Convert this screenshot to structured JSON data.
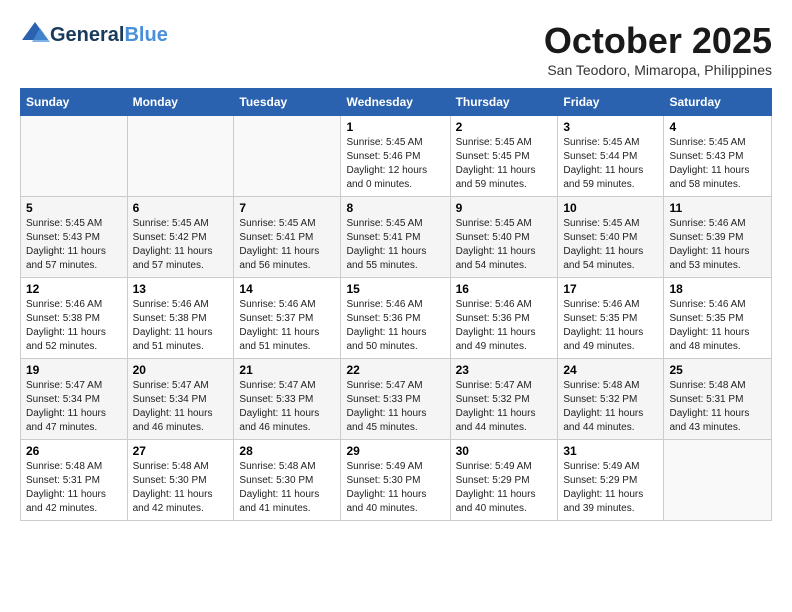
{
  "header": {
    "logo_general": "General",
    "logo_blue": "Blue",
    "month_title": "October 2025",
    "subtitle": "San Teodoro, Mimaropa, Philippines"
  },
  "weekdays": [
    "Sunday",
    "Monday",
    "Tuesday",
    "Wednesday",
    "Thursday",
    "Friday",
    "Saturday"
  ],
  "weeks": [
    [
      {
        "day": "",
        "sunrise": "",
        "sunset": "",
        "daylight": ""
      },
      {
        "day": "",
        "sunrise": "",
        "sunset": "",
        "daylight": ""
      },
      {
        "day": "",
        "sunrise": "",
        "sunset": "",
        "daylight": ""
      },
      {
        "day": "1",
        "sunrise": "Sunrise: 5:45 AM",
        "sunset": "Sunset: 5:46 PM",
        "daylight": "Daylight: 12 hours and 0 minutes."
      },
      {
        "day": "2",
        "sunrise": "Sunrise: 5:45 AM",
        "sunset": "Sunset: 5:45 PM",
        "daylight": "Daylight: 11 hours and 59 minutes."
      },
      {
        "day": "3",
        "sunrise": "Sunrise: 5:45 AM",
        "sunset": "Sunset: 5:44 PM",
        "daylight": "Daylight: 11 hours and 59 minutes."
      },
      {
        "day": "4",
        "sunrise": "Sunrise: 5:45 AM",
        "sunset": "Sunset: 5:43 PM",
        "daylight": "Daylight: 11 hours and 58 minutes."
      }
    ],
    [
      {
        "day": "5",
        "sunrise": "Sunrise: 5:45 AM",
        "sunset": "Sunset: 5:43 PM",
        "daylight": "Daylight: 11 hours and 57 minutes."
      },
      {
        "day": "6",
        "sunrise": "Sunrise: 5:45 AM",
        "sunset": "Sunset: 5:42 PM",
        "daylight": "Daylight: 11 hours and 57 minutes."
      },
      {
        "day": "7",
        "sunrise": "Sunrise: 5:45 AM",
        "sunset": "Sunset: 5:41 PM",
        "daylight": "Daylight: 11 hours and 56 minutes."
      },
      {
        "day": "8",
        "sunrise": "Sunrise: 5:45 AM",
        "sunset": "Sunset: 5:41 PM",
        "daylight": "Daylight: 11 hours and 55 minutes."
      },
      {
        "day": "9",
        "sunrise": "Sunrise: 5:45 AM",
        "sunset": "Sunset: 5:40 PM",
        "daylight": "Daylight: 11 hours and 54 minutes."
      },
      {
        "day": "10",
        "sunrise": "Sunrise: 5:45 AM",
        "sunset": "Sunset: 5:40 PM",
        "daylight": "Daylight: 11 hours and 54 minutes."
      },
      {
        "day": "11",
        "sunrise": "Sunrise: 5:46 AM",
        "sunset": "Sunset: 5:39 PM",
        "daylight": "Daylight: 11 hours and 53 minutes."
      }
    ],
    [
      {
        "day": "12",
        "sunrise": "Sunrise: 5:46 AM",
        "sunset": "Sunset: 5:38 PM",
        "daylight": "Daylight: 11 hours and 52 minutes."
      },
      {
        "day": "13",
        "sunrise": "Sunrise: 5:46 AM",
        "sunset": "Sunset: 5:38 PM",
        "daylight": "Daylight: 11 hours and 51 minutes."
      },
      {
        "day": "14",
        "sunrise": "Sunrise: 5:46 AM",
        "sunset": "Sunset: 5:37 PM",
        "daylight": "Daylight: 11 hours and 51 minutes."
      },
      {
        "day": "15",
        "sunrise": "Sunrise: 5:46 AM",
        "sunset": "Sunset: 5:36 PM",
        "daylight": "Daylight: 11 hours and 50 minutes."
      },
      {
        "day": "16",
        "sunrise": "Sunrise: 5:46 AM",
        "sunset": "Sunset: 5:36 PM",
        "daylight": "Daylight: 11 hours and 49 minutes."
      },
      {
        "day": "17",
        "sunrise": "Sunrise: 5:46 AM",
        "sunset": "Sunset: 5:35 PM",
        "daylight": "Daylight: 11 hours and 49 minutes."
      },
      {
        "day": "18",
        "sunrise": "Sunrise: 5:46 AM",
        "sunset": "Sunset: 5:35 PM",
        "daylight": "Daylight: 11 hours and 48 minutes."
      }
    ],
    [
      {
        "day": "19",
        "sunrise": "Sunrise: 5:47 AM",
        "sunset": "Sunset: 5:34 PM",
        "daylight": "Daylight: 11 hours and 47 minutes."
      },
      {
        "day": "20",
        "sunrise": "Sunrise: 5:47 AM",
        "sunset": "Sunset: 5:34 PM",
        "daylight": "Daylight: 11 hours and 46 minutes."
      },
      {
        "day": "21",
        "sunrise": "Sunrise: 5:47 AM",
        "sunset": "Sunset: 5:33 PM",
        "daylight": "Daylight: 11 hours and 46 minutes."
      },
      {
        "day": "22",
        "sunrise": "Sunrise: 5:47 AM",
        "sunset": "Sunset: 5:33 PM",
        "daylight": "Daylight: 11 hours and 45 minutes."
      },
      {
        "day": "23",
        "sunrise": "Sunrise: 5:47 AM",
        "sunset": "Sunset: 5:32 PM",
        "daylight": "Daylight: 11 hours and 44 minutes."
      },
      {
        "day": "24",
        "sunrise": "Sunrise: 5:48 AM",
        "sunset": "Sunset: 5:32 PM",
        "daylight": "Daylight: 11 hours and 44 minutes."
      },
      {
        "day": "25",
        "sunrise": "Sunrise: 5:48 AM",
        "sunset": "Sunset: 5:31 PM",
        "daylight": "Daylight: 11 hours and 43 minutes."
      }
    ],
    [
      {
        "day": "26",
        "sunrise": "Sunrise: 5:48 AM",
        "sunset": "Sunset: 5:31 PM",
        "daylight": "Daylight: 11 hours and 42 minutes."
      },
      {
        "day": "27",
        "sunrise": "Sunrise: 5:48 AM",
        "sunset": "Sunset: 5:30 PM",
        "daylight": "Daylight: 11 hours and 42 minutes."
      },
      {
        "day": "28",
        "sunrise": "Sunrise: 5:48 AM",
        "sunset": "Sunset: 5:30 PM",
        "daylight": "Daylight: 11 hours and 41 minutes."
      },
      {
        "day": "29",
        "sunrise": "Sunrise: 5:49 AM",
        "sunset": "Sunset: 5:30 PM",
        "daylight": "Daylight: 11 hours and 40 minutes."
      },
      {
        "day": "30",
        "sunrise": "Sunrise: 5:49 AM",
        "sunset": "Sunset: 5:29 PM",
        "daylight": "Daylight: 11 hours and 40 minutes."
      },
      {
        "day": "31",
        "sunrise": "Sunrise: 5:49 AM",
        "sunset": "Sunset: 5:29 PM",
        "daylight": "Daylight: 11 hours and 39 minutes."
      },
      {
        "day": "",
        "sunrise": "",
        "sunset": "",
        "daylight": ""
      }
    ]
  ]
}
